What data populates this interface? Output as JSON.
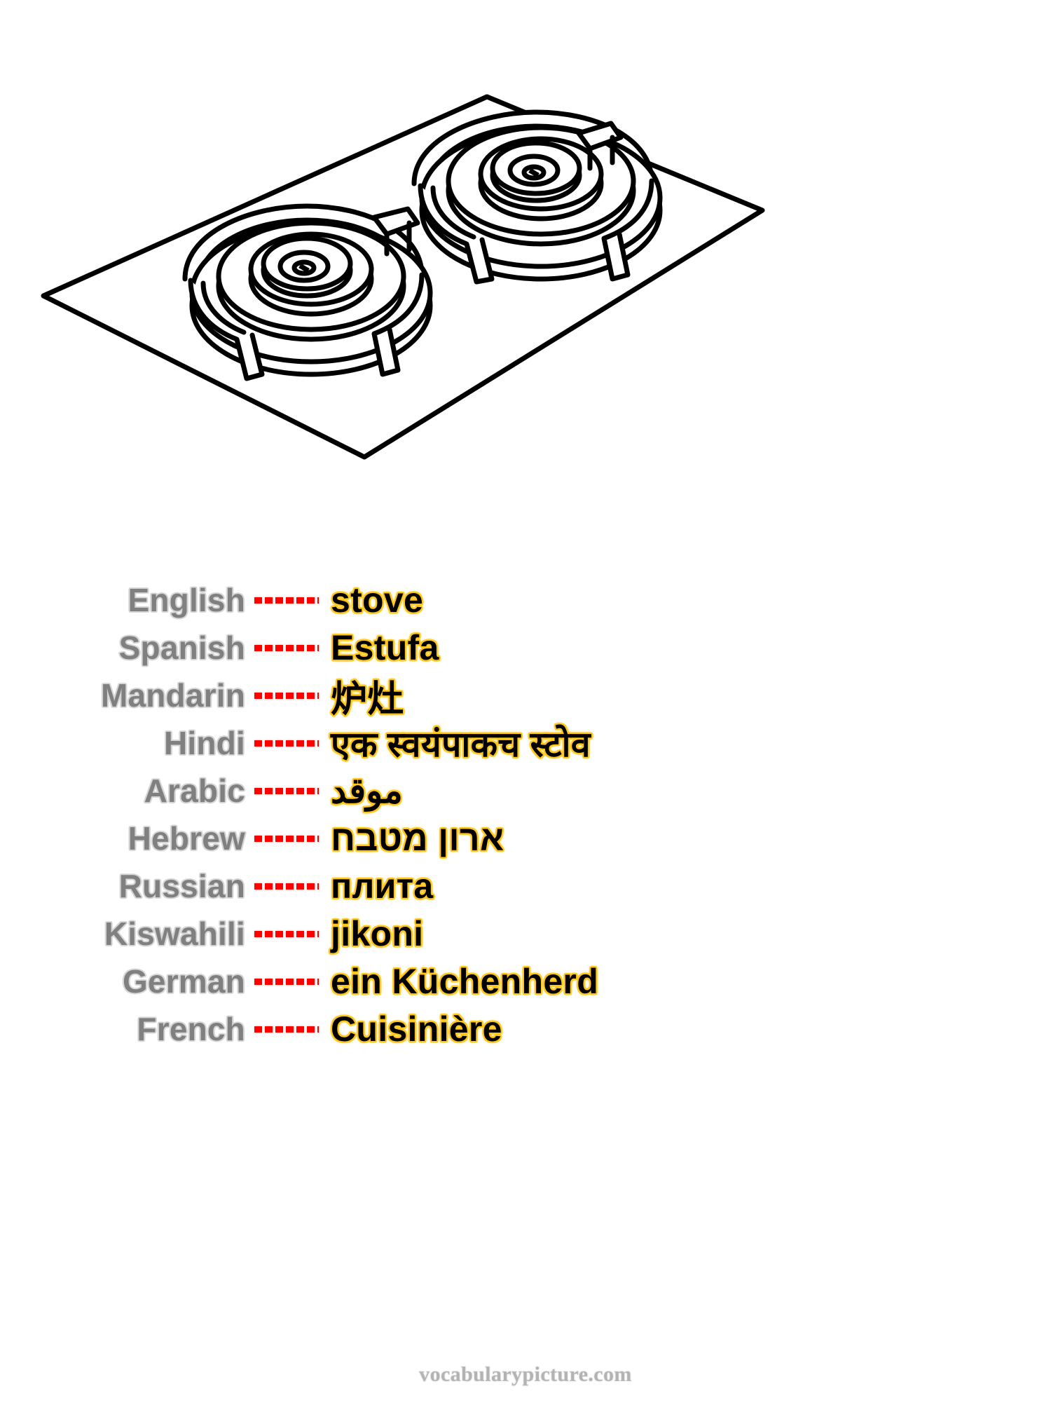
{
  "illustration": {
    "name": "gas-stove-cooktop-line-drawing",
    "description": "Black-and-white line drawing of a two-burner gas stove cooktop seen in isometric perspective, with two round burners, pan supports and two control knobs",
    "stroke_color": "#000000",
    "fill_color": "#ffffff",
    "burner_count": 2,
    "knob_count": 2
  },
  "vocabulary": {
    "separator": "------",
    "rows": [
      {
        "language": "English",
        "word": "stove"
      },
      {
        "language": "Spanish",
        "word": "Estufa"
      },
      {
        "language": "Mandarin",
        "word": "炉灶"
      },
      {
        "language": "Hindi",
        "word": "एक स्वयंपाकच स्टोव"
      },
      {
        "language": "Arabic",
        "word": "موقد"
      },
      {
        "language": "Hebrew",
        "word": "ארון מטבח"
      },
      {
        "language": "Russian",
        "word": "плита"
      },
      {
        "language": "Kiswahili",
        "word": "jikoni"
      },
      {
        "language": "German",
        "word": "ein Küchenherd"
      },
      {
        "language": "French",
        "word": "Cuisinière"
      }
    ]
  },
  "footer": {
    "site": "vocabularypicture.com"
  },
  "colors": {
    "background": "#ffffff",
    "language_label": "#808080",
    "language_label_outline": "#d6d6d6",
    "separator_dash": "#ff0000",
    "word_text": "#000000",
    "word_highlight": "#ffc61e",
    "footer_text": "#b3b3b3"
  }
}
